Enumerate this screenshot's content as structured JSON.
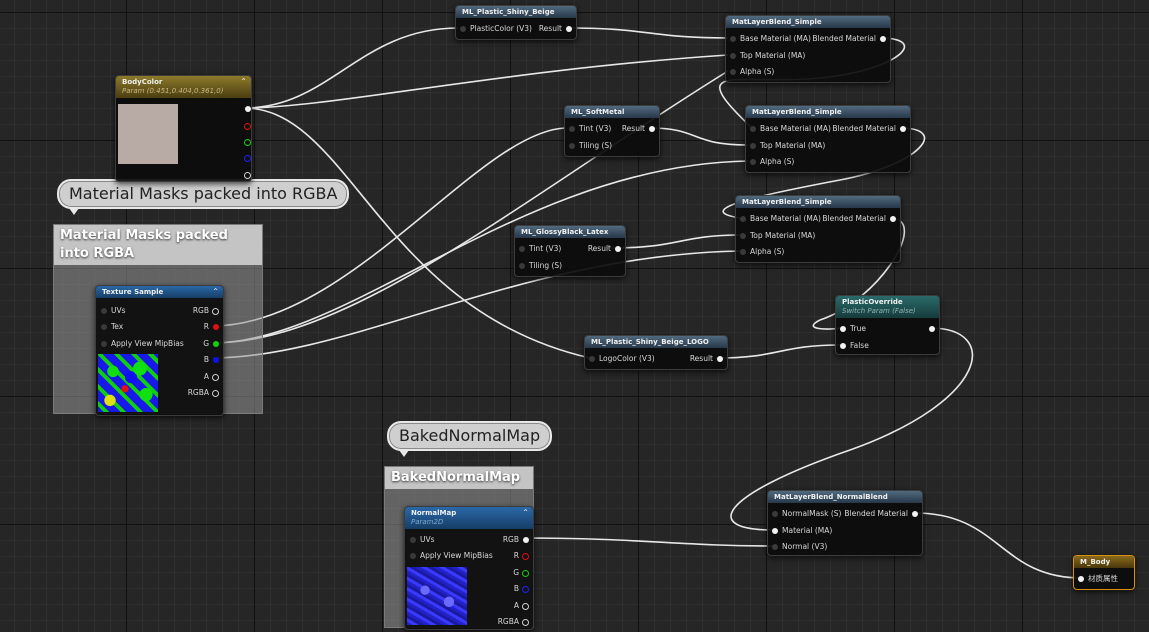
{
  "comments": {
    "masks": {
      "bubble": "Material Masks packed into RGBA",
      "title": "Material Masks packed into RGBA"
    },
    "normal": {
      "bubble": "BakedNormalMap",
      "title": "BakedNormalMap"
    }
  },
  "nodes": {
    "body_color": {
      "title": "BodyColor",
      "subtitle": "Param (0.451,0.404,0.361,0)",
      "swatch_color": "#b8aaa5"
    },
    "ml_plastic_shiny_beige": {
      "title": "ML_Plastic_Shiny_Beige",
      "in": "PlasticColor (V3)",
      "out": "Result"
    },
    "ml_softmetal": {
      "title": "ML_SoftMetal",
      "in1": "Tint (V3)",
      "in2": "Tiling (S)",
      "out": "Result"
    },
    "ml_glossyblack_latex": {
      "title": "ML_GlossyBlack_Latex",
      "in1": "Tint (V3)",
      "in2": "Tiling (S)",
      "out": "Result"
    },
    "ml_plastic_logo": {
      "title": "ML_Plastic_Shiny_Beige_LOGO",
      "in": "LogoColor (V3)",
      "out": "Result"
    },
    "blend1": {
      "title": "MatLayerBlend_Simple",
      "in1": "Base Material (MA)",
      "in2": "Top Material (MA)",
      "in3": "Alpha (S)",
      "out": "Blended Material"
    },
    "blend2": {
      "title": "MatLayerBlend_Simple",
      "in1": "Base Material (MA)",
      "in2": "Top Material (MA)",
      "in3": "Alpha (S)",
      "out": "Blended Material"
    },
    "blend3": {
      "title": "MatLayerBlend_Simple",
      "in1": "Base Material (MA)",
      "in2": "Top Material (MA)",
      "in3": "Alpha (S)",
      "out": "Blended Material"
    },
    "plastic_override": {
      "title": "PlasticOverride",
      "subtitle": "Switch Param (False)",
      "in1": "True",
      "in2": "False"
    },
    "texture_sample": {
      "title": "Texture Sample",
      "in1": "UVs",
      "in2": "Tex",
      "in3": "Apply View MipBias",
      "out_rgb": "RGB",
      "out_r": "R",
      "out_g": "G",
      "out_b": "B",
      "out_a": "A",
      "out_rgba": "RGBA"
    },
    "normal_map": {
      "title": "NormalMap",
      "subtitle": "Param2D",
      "in1": "UVs",
      "in2": "Apply View MipBias",
      "out_rgb": "RGB",
      "out_r": "R",
      "out_g": "G",
      "out_b": "B",
      "out_a": "A",
      "out_rgba": "RGBA"
    },
    "blend_normal": {
      "title": "MatLayerBlend_NormalBlend",
      "in1": "NormalMask (S)",
      "in2": "Material (MA)",
      "in3": "Normal (V3)",
      "out": "Blended Material"
    },
    "m_body": {
      "title": "M_Body",
      "in": "材质属性"
    }
  }
}
